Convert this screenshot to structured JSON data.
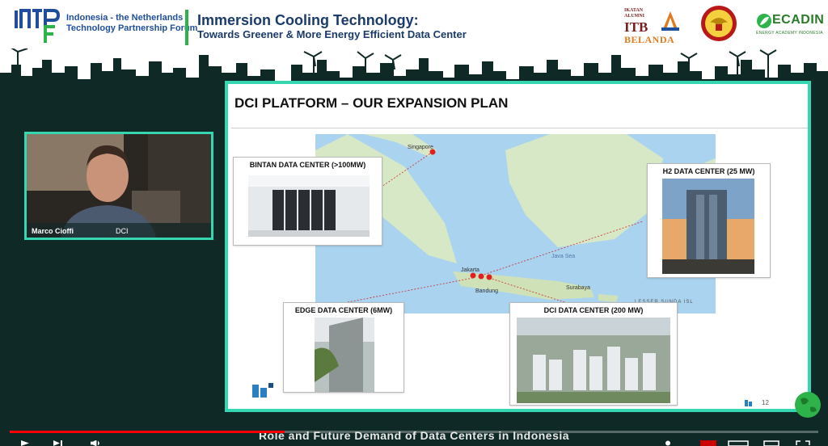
{
  "header": {
    "org_line1": "Indonesia - the Netherlands",
    "org_line2": "Technology Partnership Forum",
    "event_title": "Immersion Cooling Technology:",
    "event_subtitle": "Towards Greener & More Energy Efficient Data Center",
    "itb_small_line1": "IKATAN",
    "itb_small_line2": "ALUMNI",
    "itb_big": "ITB",
    "itb_belanda": "BELANDA",
    "ecadin_word": "ECADIN",
    "ecadin_sub": "ENERGY ACADEMY INDONESIA"
  },
  "webcam": {
    "name": "Marco Cioffi",
    "tag": "DCI"
  },
  "slide": {
    "title": "DCI PLATFORM – OUR EXPANSION PLAN",
    "page_number": "12",
    "callouts": {
      "bintan": "BINTAN DATA CENTER (>100MW)",
      "h2": "H2 DATA CENTER (25 MW)",
      "edge": "EDGE DATA CENTER (6MW)",
      "dci": "DCI DATA CENTER (200 MW)"
    },
    "map_labels": {
      "singapore": "Singapore",
      "jakarta": "Jakarta",
      "bandung": "Bandung",
      "surabaya": "Surabaya",
      "java_sea": "Java Sea",
      "lesser_sunda": "LESSER SUNDA ISL"
    }
  },
  "player": {
    "caption": "Role and Future Demand of Data Centers in Indonesia",
    "progress": 0.34,
    "accent": "#ff0000"
  },
  "theme": {
    "frame_accent": "#35d6b0",
    "background": "#0f2a26",
    "brand_blue": "#1f4e9c",
    "brand_green": "#2db34a"
  }
}
